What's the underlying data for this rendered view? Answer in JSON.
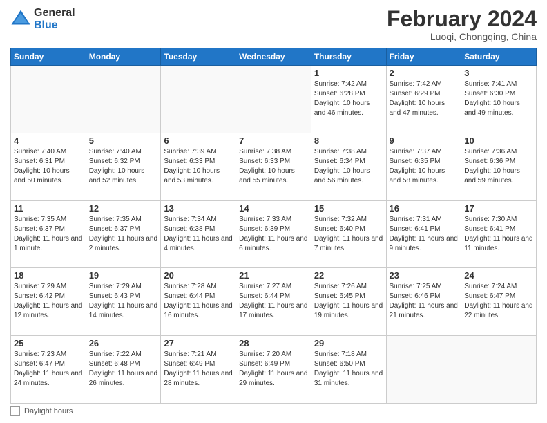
{
  "logo": {
    "general": "General",
    "blue": "Blue"
  },
  "title": "February 2024",
  "subtitle": "Luoqi, Chongqing, China",
  "days_of_week": [
    "Sunday",
    "Monday",
    "Tuesday",
    "Wednesday",
    "Thursday",
    "Friday",
    "Saturday"
  ],
  "legend_label": "Daylight hours",
  "weeks": [
    [
      {
        "day": "",
        "info": ""
      },
      {
        "day": "",
        "info": ""
      },
      {
        "day": "",
        "info": ""
      },
      {
        "day": "",
        "info": ""
      },
      {
        "day": "1",
        "info": "Sunrise: 7:42 AM\nSunset: 6:28 PM\nDaylight: 10 hours and 46 minutes."
      },
      {
        "day": "2",
        "info": "Sunrise: 7:42 AM\nSunset: 6:29 PM\nDaylight: 10 hours and 47 minutes."
      },
      {
        "day": "3",
        "info": "Sunrise: 7:41 AM\nSunset: 6:30 PM\nDaylight: 10 hours and 49 minutes."
      }
    ],
    [
      {
        "day": "4",
        "info": "Sunrise: 7:40 AM\nSunset: 6:31 PM\nDaylight: 10 hours and 50 minutes."
      },
      {
        "day": "5",
        "info": "Sunrise: 7:40 AM\nSunset: 6:32 PM\nDaylight: 10 hours and 52 minutes."
      },
      {
        "day": "6",
        "info": "Sunrise: 7:39 AM\nSunset: 6:33 PM\nDaylight: 10 hours and 53 minutes."
      },
      {
        "day": "7",
        "info": "Sunrise: 7:38 AM\nSunset: 6:33 PM\nDaylight: 10 hours and 55 minutes."
      },
      {
        "day": "8",
        "info": "Sunrise: 7:38 AM\nSunset: 6:34 PM\nDaylight: 10 hours and 56 minutes."
      },
      {
        "day": "9",
        "info": "Sunrise: 7:37 AM\nSunset: 6:35 PM\nDaylight: 10 hours and 58 minutes."
      },
      {
        "day": "10",
        "info": "Sunrise: 7:36 AM\nSunset: 6:36 PM\nDaylight: 10 hours and 59 minutes."
      }
    ],
    [
      {
        "day": "11",
        "info": "Sunrise: 7:35 AM\nSunset: 6:37 PM\nDaylight: 11 hours and 1 minute."
      },
      {
        "day": "12",
        "info": "Sunrise: 7:35 AM\nSunset: 6:37 PM\nDaylight: 11 hours and 2 minutes."
      },
      {
        "day": "13",
        "info": "Sunrise: 7:34 AM\nSunset: 6:38 PM\nDaylight: 11 hours and 4 minutes."
      },
      {
        "day": "14",
        "info": "Sunrise: 7:33 AM\nSunset: 6:39 PM\nDaylight: 11 hours and 6 minutes."
      },
      {
        "day": "15",
        "info": "Sunrise: 7:32 AM\nSunset: 6:40 PM\nDaylight: 11 hours and 7 minutes."
      },
      {
        "day": "16",
        "info": "Sunrise: 7:31 AM\nSunset: 6:41 PM\nDaylight: 11 hours and 9 minutes."
      },
      {
        "day": "17",
        "info": "Sunrise: 7:30 AM\nSunset: 6:41 PM\nDaylight: 11 hours and 11 minutes."
      }
    ],
    [
      {
        "day": "18",
        "info": "Sunrise: 7:29 AM\nSunset: 6:42 PM\nDaylight: 11 hours and 12 minutes."
      },
      {
        "day": "19",
        "info": "Sunrise: 7:29 AM\nSunset: 6:43 PM\nDaylight: 11 hours and 14 minutes."
      },
      {
        "day": "20",
        "info": "Sunrise: 7:28 AM\nSunset: 6:44 PM\nDaylight: 11 hours and 16 minutes."
      },
      {
        "day": "21",
        "info": "Sunrise: 7:27 AM\nSunset: 6:44 PM\nDaylight: 11 hours and 17 minutes."
      },
      {
        "day": "22",
        "info": "Sunrise: 7:26 AM\nSunset: 6:45 PM\nDaylight: 11 hours and 19 minutes."
      },
      {
        "day": "23",
        "info": "Sunrise: 7:25 AM\nSunset: 6:46 PM\nDaylight: 11 hours and 21 minutes."
      },
      {
        "day": "24",
        "info": "Sunrise: 7:24 AM\nSunset: 6:47 PM\nDaylight: 11 hours and 22 minutes."
      }
    ],
    [
      {
        "day": "25",
        "info": "Sunrise: 7:23 AM\nSunset: 6:47 PM\nDaylight: 11 hours and 24 minutes."
      },
      {
        "day": "26",
        "info": "Sunrise: 7:22 AM\nSunset: 6:48 PM\nDaylight: 11 hours and 26 minutes."
      },
      {
        "day": "27",
        "info": "Sunrise: 7:21 AM\nSunset: 6:49 PM\nDaylight: 11 hours and 28 minutes."
      },
      {
        "day": "28",
        "info": "Sunrise: 7:20 AM\nSunset: 6:49 PM\nDaylight: 11 hours and 29 minutes."
      },
      {
        "day": "29",
        "info": "Sunrise: 7:18 AM\nSunset: 6:50 PM\nDaylight: 11 hours and 31 minutes."
      },
      {
        "day": "",
        "info": ""
      },
      {
        "day": "",
        "info": ""
      }
    ]
  ]
}
